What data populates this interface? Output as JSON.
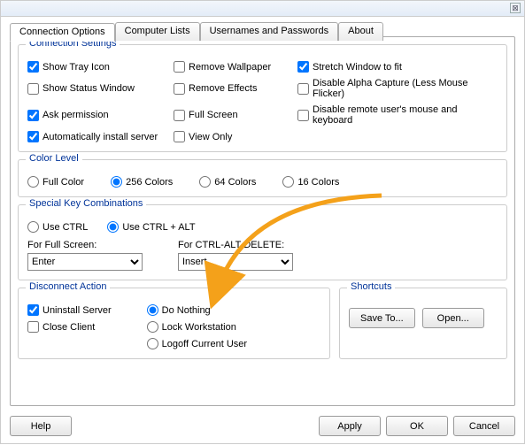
{
  "tabs": {
    "connection": "Connection Options",
    "computers": "Computer Lists",
    "users": "Usernames and Passwords",
    "about": "About"
  },
  "connSettings": {
    "legend": "Connection Settings",
    "showTray": "Show Tray Icon",
    "showStatus": "Show Status Window",
    "askPerm": "Ask permission",
    "autoInstall": "Automatically install server",
    "removeWall": "Remove Wallpaper",
    "removeEff": "Remove Effects",
    "fullScreen": "Full Screen",
    "viewOnly": "View Only",
    "stretch": "Stretch Window to fit",
    "disableAlpha": "Disable Alpha Capture (Less Mouse Flicker)",
    "disableRemote": "Disable remote user's mouse and keyboard"
  },
  "colorLevel": {
    "legend": "Color Level",
    "full": "Full Color",
    "c256": "256 Colors",
    "c64": "64 Colors",
    "c16": "16 Colors"
  },
  "specialKeys": {
    "legend": "Special Key Combinations",
    "useCtrl": "Use CTRL",
    "useCtrlAlt": "Use CTRL + ALT",
    "forFull": "For Full Screen:",
    "forCAD": "For CTRL-ALT-DELETE:",
    "enter": "Enter",
    "insert": "Insert"
  },
  "disconnect": {
    "legend": "Disconnect Action",
    "uninstall": "Uninstall Server",
    "closeClient": "Close Client",
    "doNothing": "Do Nothing",
    "lock": "Lock Workstation",
    "logoff": "Logoff Current User"
  },
  "shortcuts": {
    "legend": "Shortcuts",
    "saveTo": "Save To...",
    "open": "Open..."
  },
  "footer": {
    "help": "Help",
    "apply": "Apply",
    "ok": "OK",
    "cancel": "Cancel"
  }
}
